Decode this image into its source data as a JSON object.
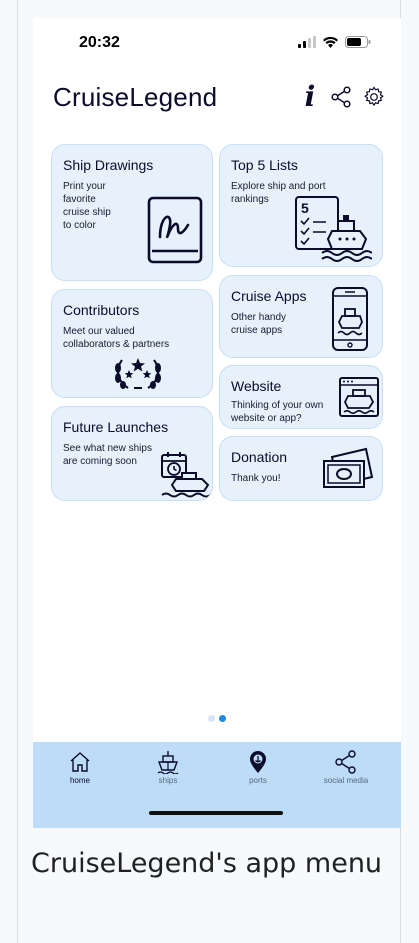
{
  "status": {
    "time": "20:32"
  },
  "app": {
    "title": "CruiseLegend"
  },
  "header": {
    "info_icon": "i"
  },
  "cards": {
    "ship_drawings": {
      "title": "Ship Drawings",
      "subtitle_lines": [
        "Print your",
        "favorite",
        "cruise ship",
        "to color"
      ]
    },
    "top5": {
      "title": "Top 5 Lists",
      "subtitle_lines": [
        "Explore ship and port",
        "rankings"
      ]
    },
    "contributors": {
      "title": "Contributors",
      "subtitle_lines": [
        "Meet our valued",
        "collaborators & partners"
      ]
    },
    "cruise_apps": {
      "title": "Cruise Apps",
      "subtitle_lines": [
        "Other handy",
        "cruise apps"
      ]
    },
    "website": {
      "title": "Website",
      "subtitle_lines": [
        "Thinking of your own",
        "website or app?"
      ]
    },
    "future_launches": {
      "title": "Future Launches",
      "subtitle_lines": [
        "See what new ships",
        "are coming soon"
      ]
    },
    "donation": {
      "title": "Donation",
      "subtitle_lines": [
        "Thank you!"
      ]
    }
  },
  "pager": {
    "pages": 2,
    "active": 2
  },
  "tabbar": {
    "home": "home",
    "ships": "ships",
    "ports": "ports",
    "social": "social media"
  },
  "caption": "CruiseLegend's app menu",
  "colors": {
    "card_bg": "#e6f1fc",
    "tabbar_bg": "#bcdcf7",
    "accent": "#1e88e5",
    "ink": "#0b0b2a"
  }
}
